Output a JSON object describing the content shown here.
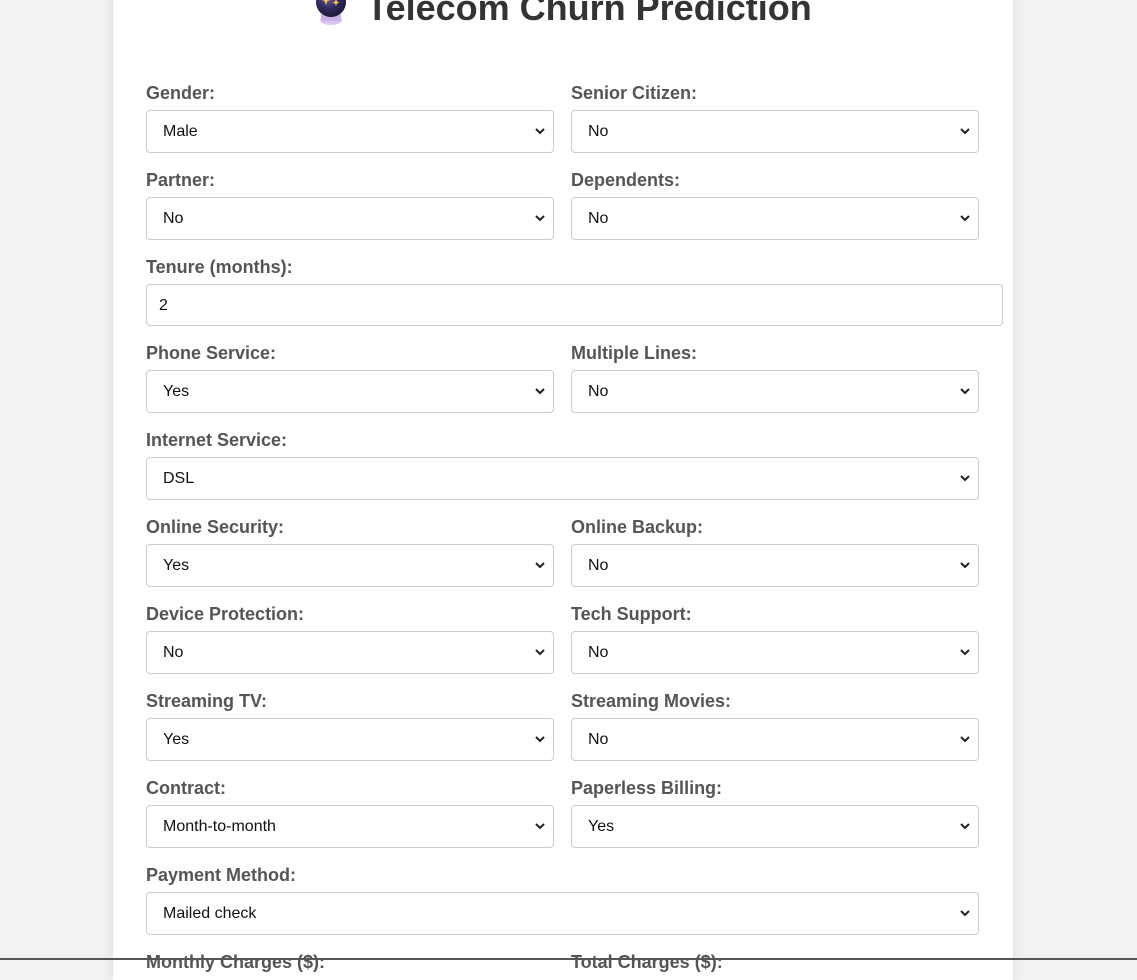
{
  "page": {
    "title": "Telecom Churn Prediction",
    "title_icon": "crystal-ball-icon"
  },
  "form": {
    "gender": {
      "label": "Gender:",
      "value": "Male"
    },
    "senior_citizen": {
      "label": "Senior Citizen:",
      "value": "No"
    },
    "partner": {
      "label": "Partner:",
      "value": "No"
    },
    "dependents": {
      "label": "Dependents:",
      "value": "No"
    },
    "tenure": {
      "label": "Tenure (months):",
      "value": "2"
    },
    "phone_service": {
      "label": "Phone Service:",
      "value": "Yes"
    },
    "multiple_lines": {
      "label": "Multiple Lines:",
      "value": "No"
    },
    "internet_service": {
      "label": "Internet Service:",
      "value": "DSL"
    },
    "online_security": {
      "label": "Online Security:",
      "value": "Yes"
    },
    "online_backup": {
      "label": "Online Backup:",
      "value": "No"
    },
    "device_protection": {
      "label": "Device Protection:",
      "value": "No"
    },
    "tech_support": {
      "label": "Tech Support:",
      "value": "No"
    },
    "streaming_tv": {
      "label": "Streaming TV:",
      "value": "Yes"
    },
    "streaming_movies": {
      "label": "Streaming Movies:",
      "value": "No"
    },
    "contract": {
      "label": "Contract:",
      "value": "Month-to-month"
    },
    "paperless_billing": {
      "label": "Paperless Billing:",
      "value": "Yes"
    },
    "payment_method": {
      "label": "Payment Method:",
      "value": "Mailed check"
    },
    "monthly_charges": {
      "label": "Monthly Charges ($):"
    },
    "total_charges": {
      "label": "Total Charges ($):"
    }
  }
}
